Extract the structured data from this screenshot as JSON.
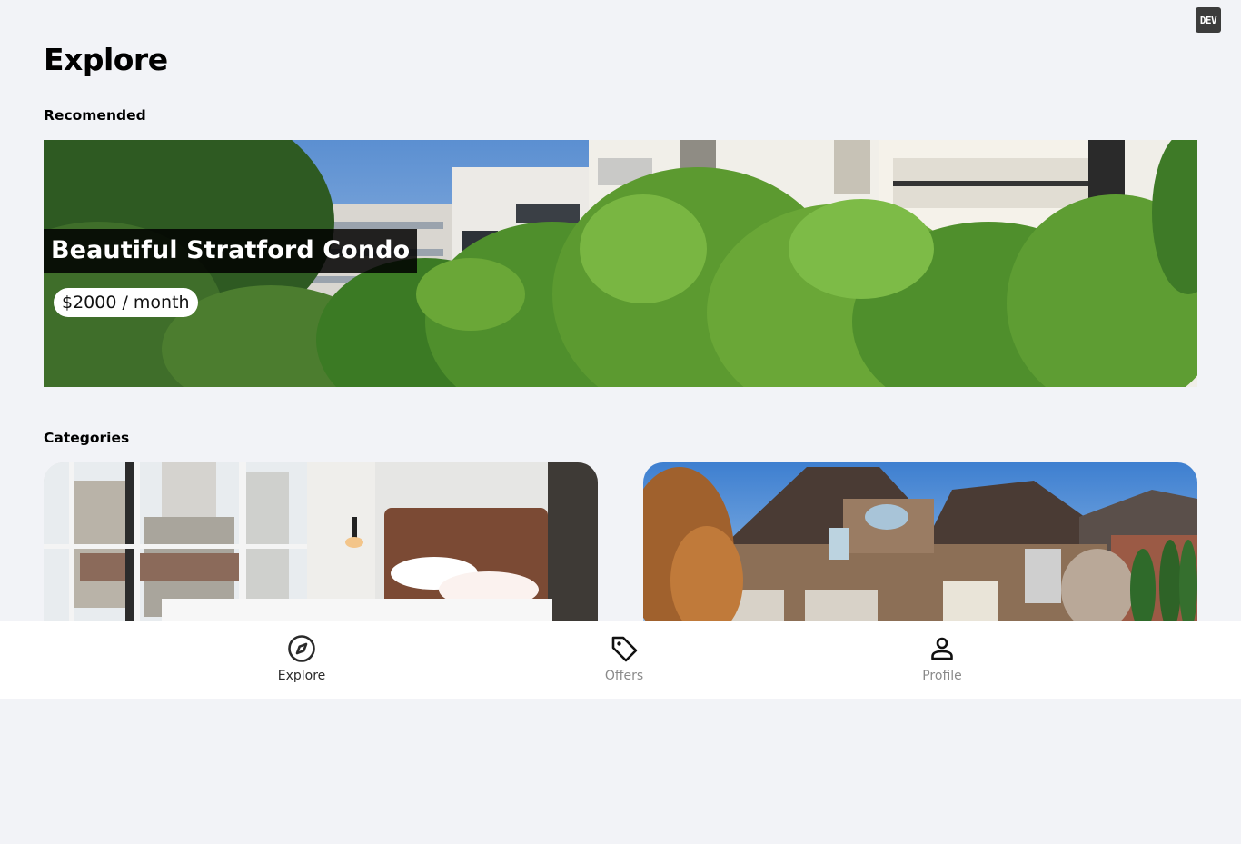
{
  "app": {
    "dev_badge": "DEV",
    "page_title": "Explore"
  },
  "recommended": {
    "section_label": "Recomended",
    "listing": {
      "title": "Beautiful Stratford Condo",
      "price": "$2000 / month",
      "image": "condo-building-with-trees"
    }
  },
  "categories": {
    "section_label": "Categories",
    "cards": [
      {
        "image": "bedroom-with-city-view"
      },
      {
        "image": "suburban-brick-house"
      }
    ]
  },
  "tabbar": {
    "items": [
      {
        "label": "Explore",
        "icon": "compass-icon",
        "active": true
      },
      {
        "label": "Offers",
        "icon": "tag-icon",
        "active": false
      },
      {
        "label": "Profile",
        "icon": "person-icon",
        "active": false
      }
    ]
  },
  "colors": {
    "background": "#f2f3f7",
    "tab_active": "#2a2a2a",
    "tab_inactive": "#8a8a8a"
  }
}
